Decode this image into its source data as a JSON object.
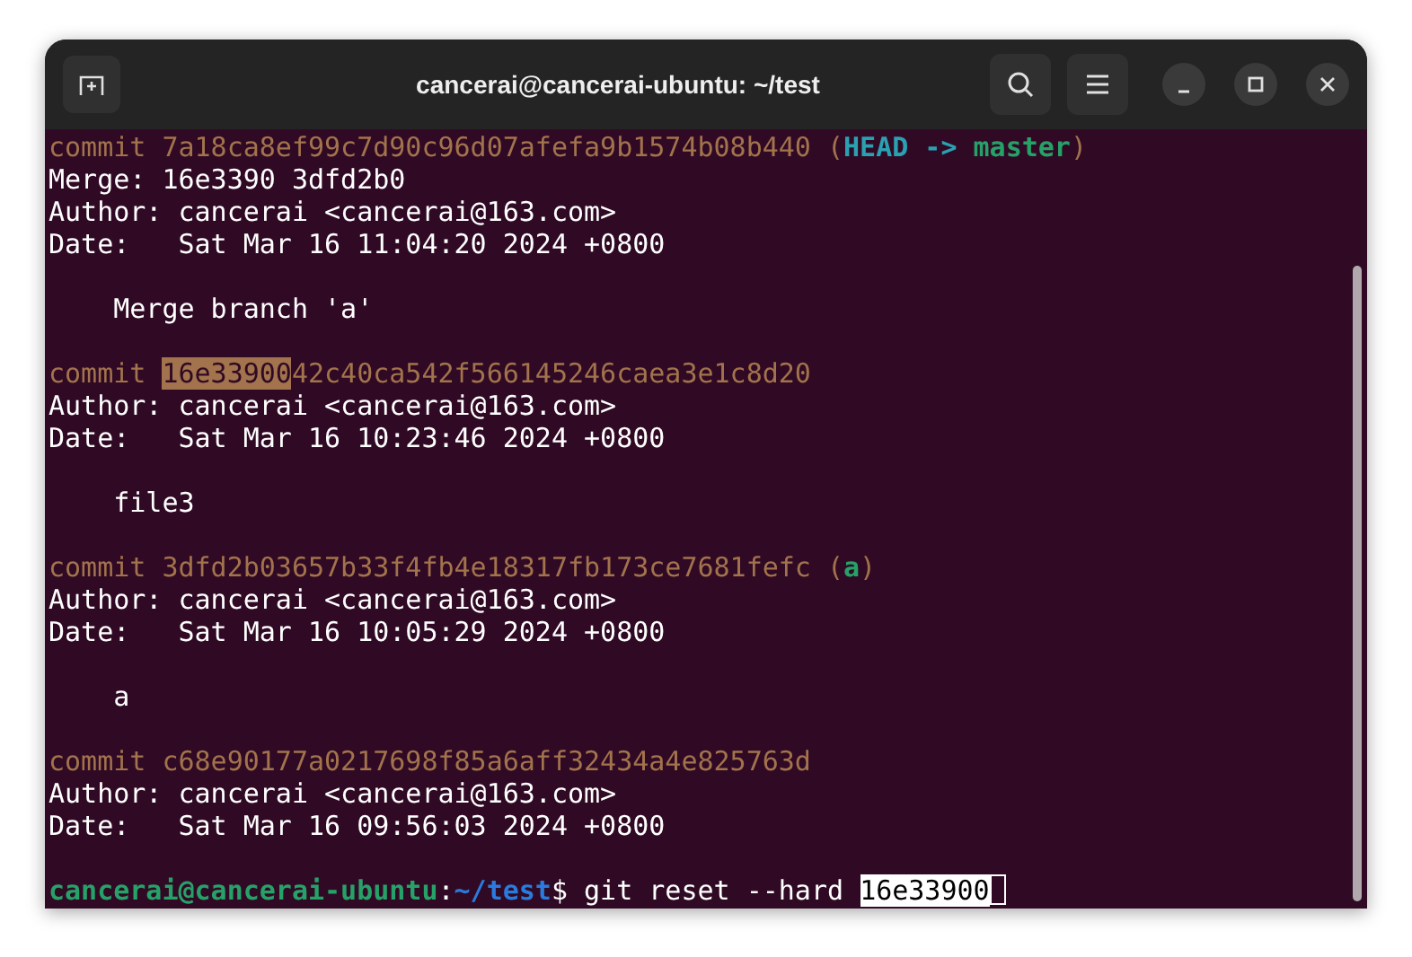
{
  "window": {
    "title": "cancerai@cancerai-ubuntu: ~/test"
  },
  "commits": [
    {
      "word": "commit",
      "hash": [
        {
          "text": "7a18ca8ef99c7d90c96d07afefa9b1574b08b440",
          "selected": false
        }
      ],
      "refs": [
        {
          "text": "(",
          "kind": "paren"
        },
        {
          "text": "HEAD ->",
          "kind": "head"
        },
        {
          "text": "master",
          "kind": "branch"
        },
        {
          "text": ")",
          "kind": "paren"
        }
      ],
      "fields": [
        {
          "label": "Merge:",
          "value": "16e3390 3dfd2b0"
        },
        {
          "label": "Author:",
          "value": "cancerai <cancerai@163.com>"
        },
        {
          "label": "Date:",
          "value": "Sat Mar 16 11:04:20 2024 +0800"
        }
      ],
      "message": "Merge branch 'a'"
    },
    {
      "word": "commit",
      "hash": [
        {
          "text": "16e33900",
          "selected": true
        },
        {
          "text": "42c40ca542f566145246caea3e1c8d20",
          "selected": false
        }
      ],
      "fields": [
        {
          "label": "Author:",
          "value": "cancerai <cancerai@163.com>"
        },
        {
          "label": "Date:",
          "value": "Sat Mar 16 10:23:46 2024 +0800"
        }
      ],
      "message": "file3"
    },
    {
      "word": "commit",
      "hash": [
        {
          "text": "3dfd2b03657b33f4fb4e18317fb173ce7681fefc",
          "selected": false
        }
      ],
      "refs": [
        {
          "text": "(",
          "kind": "paren"
        },
        {
          "text": "a",
          "kind": "branch"
        },
        {
          "text": ")",
          "kind": "paren"
        }
      ],
      "fields": [
        {
          "label": "Author:",
          "value": "cancerai <cancerai@163.com>"
        },
        {
          "label": "Date:",
          "value": "Sat Mar 16 10:05:29 2024 +0800"
        }
      ],
      "message": "a"
    },
    {
      "word": "commit",
      "hash": [
        {
          "text": "c68e90177a0217698f85a6aff32434a4e825763d",
          "selected": false
        }
      ],
      "fields": [
        {
          "label": "Author:",
          "value": "cancerai <cancerai@163.com>"
        },
        {
          "label": "Date:",
          "value": "Sat Mar 16 09:56:03 2024 +0800"
        }
      ]
    }
  ],
  "prompt": [
    {
      "text": "cancerai@cancerai-ubuntu",
      "kind": "user"
    },
    {
      "text": ":",
      "kind": "plain"
    },
    {
      "text": "~/test",
      "kind": "path"
    },
    {
      "text": "$ git reset --hard",
      "kind": "plain"
    },
    {
      "text": "16e33900",
      "kind": "selection"
    }
  ]
}
